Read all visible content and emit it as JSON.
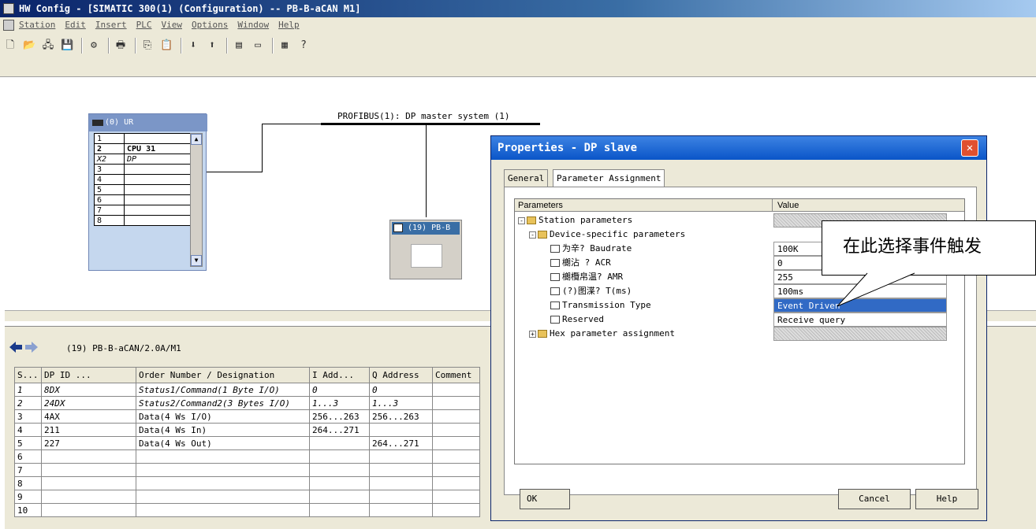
{
  "window": {
    "title": "HW Config - [SIMATIC 300(1) (Configuration) -- PB-B-aCAN M1]"
  },
  "menubar": [
    "Station",
    "Edit",
    "Insert",
    "PLC",
    "View",
    "Options",
    "Window",
    "Help"
  ],
  "toolbar": {
    "icons": [
      "new-icon",
      "open-icon",
      "network-icon",
      "save-icon",
      "compile-icon",
      "print-icon",
      "copy-icon",
      "paste-icon",
      "download-icon",
      "upload-icon",
      "catalog-icon",
      "view-icon",
      "netpro-icon",
      "help-pointer-icon"
    ]
  },
  "station": {
    "rack_title": "(0) UR",
    "rack_rows": [
      {
        "slot": "1",
        "module": ""
      },
      {
        "slot": "2",
        "module": "CPU 31"
      },
      {
        "slot": "X2",
        "module": "DP"
      },
      {
        "slot": "3",
        "module": ""
      },
      {
        "slot": "4",
        "module": ""
      },
      {
        "slot": "5",
        "module": ""
      },
      {
        "slot": "6",
        "module": ""
      },
      {
        "slot": "7",
        "module": ""
      },
      {
        "slot": "8",
        "module": ""
      }
    ],
    "network_label": "PROFIBUS(1): DP master system (1)",
    "slave_label": "(19) PB-B"
  },
  "detail": {
    "title": "(19)   PB-B-aCAN/2.0A/M1",
    "columns": [
      "S...",
      "DP ID ...",
      "Order Number / Designation",
      "I Add...",
      "Q Address",
      "Comment"
    ],
    "rows": [
      {
        "s": "1",
        "dpid": "8DX",
        "order": "Status1/Command(1 Byte I/O)",
        "iadd": "0",
        "qadd": "0",
        "comment": "",
        "italic": true
      },
      {
        "s": "2",
        "dpid": "24DX",
        "order": "Status2/Command2(3 Bytes I/O)",
        "iadd": "1...3",
        "qadd": "1...3",
        "comment": "",
        "italic": true
      },
      {
        "s": "3",
        "dpid": "4AX",
        "order": "Data(4 Ws I/O)",
        "iadd": "256...263",
        "qadd": "256...263",
        "comment": ""
      },
      {
        "s": "4",
        "dpid": "211",
        "order": "Data(4 Ws In)",
        "iadd": "264...271",
        "qadd": "",
        "comment": ""
      },
      {
        "s": "5",
        "dpid": "227",
        "order": "Data(4 Ws Out)",
        "iadd": "",
        "qadd": "264...271",
        "comment": ""
      },
      {
        "s": "6",
        "dpid": "",
        "order": "",
        "iadd": "",
        "qadd": "",
        "comment": ""
      },
      {
        "s": "7",
        "dpid": "",
        "order": "",
        "iadd": "",
        "qadd": "",
        "comment": ""
      },
      {
        "s": "8",
        "dpid": "",
        "order": "",
        "iadd": "",
        "qadd": "",
        "comment": ""
      },
      {
        "s": "9",
        "dpid": "",
        "order": "",
        "iadd": "",
        "qadd": "",
        "comment": ""
      },
      {
        "s": "10",
        "dpid": "",
        "order": "",
        "iadd": "",
        "qadd": "",
        "comment": ""
      }
    ]
  },
  "dialog": {
    "title": "Properties - DP slave",
    "tabs": [
      "General",
      "Parameter Assignment"
    ],
    "header_params": "Parameters",
    "header_value": "Value",
    "rows": [
      {
        "name": "Station parameters",
        "value": "",
        "kind": "folder",
        "indent": 1,
        "toggle": "-",
        "val_style": "hatch"
      },
      {
        "name": "Device-specific parameters",
        "value": "",
        "kind": "folder",
        "indent": 2,
        "toggle": "-",
        "val_style": "none"
      },
      {
        "name": "为辛?       Baudrate",
        "value": "100K",
        "kind": "doc",
        "indent": 3,
        "toggle": "",
        "val_style": "plain"
      },
      {
        "name": "樃沾  ?      ACR",
        "value": "0",
        "kind": "doc",
        "indent": 3,
        "toggle": "",
        "val_style": "plain"
      },
      {
        "name": "樃欖帛温?   AMR",
        "value": "255",
        "kind": "doc",
        "indent": 3,
        "toggle": "",
        "val_style": "plain"
      },
      {
        "name": "(?)图渫?     T(ms)",
        "value": "100ms",
        "kind": "doc",
        "indent": 3,
        "toggle": "",
        "val_style": "plain"
      },
      {
        "name": "Transmission Type",
        "value": "Event Driven",
        "kind": "doc",
        "indent": 3,
        "toggle": "",
        "val_style": "sel"
      },
      {
        "name": "Reserved",
        "value": "Receive query",
        "kind": "doc",
        "indent": 3,
        "toggle": "",
        "val_style": "plain"
      },
      {
        "name": "Hex parameter assignment",
        "value": "",
        "kind": "folder",
        "indent": 2,
        "toggle": "+",
        "val_style": "hatch"
      }
    ],
    "ok": "OK",
    "cancel": "Cancel",
    "help": "Help"
  },
  "callout": {
    "text": "在此选择事件触发"
  }
}
